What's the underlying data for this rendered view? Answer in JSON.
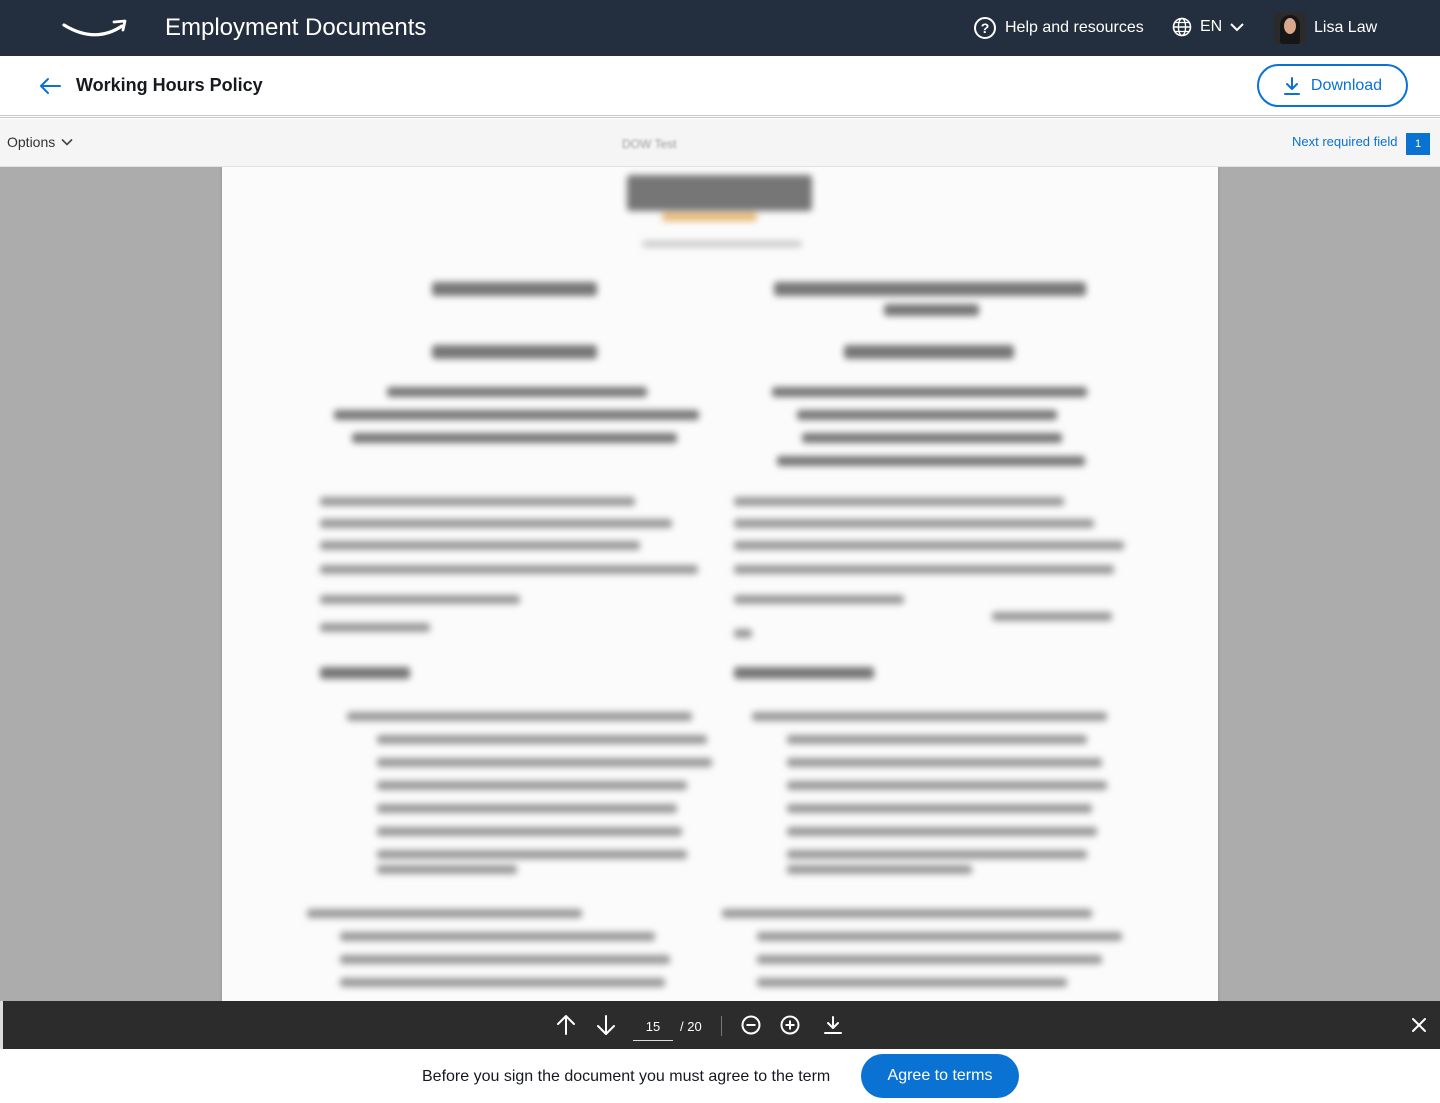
{
  "app": {
    "title": "Employment Documents"
  },
  "topbar": {
    "help_label": "Help and  resources",
    "help_symbol": "?",
    "language": "EN",
    "user_name": "Lisa Law"
  },
  "header": {
    "document_title": "Working Hours Policy",
    "download_label": "Download"
  },
  "options_bar": {
    "options_label": "Options",
    "document_name": "DOW Test",
    "next_required_label": "Next required field",
    "next_required_count": "1"
  },
  "toolbar": {
    "current_page": "15",
    "total_pages": "/ 20"
  },
  "footer": {
    "notice": "Before you sign the document you must agree to the term",
    "agree_label": "Agree to terms"
  },
  "colors": {
    "topbar_bg": "#232f3e",
    "accent": "#0972d3",
    "viewer_bg": "#acacac",
    "toolbar_bg": "#2c2c2c"
  },
  "icons": [
    "amazon-smile-logo-icon",
    "help-icon",
    "globe-icon",
    "chevron-down-icon",
    "arrow-left-icon",
    "download-icon",
    "arrow-up-icon",
    "arrow-down-icon",
    "zoom-out-icon",
    "zoom-in-icon",
    "close-icon"
  ]
}
